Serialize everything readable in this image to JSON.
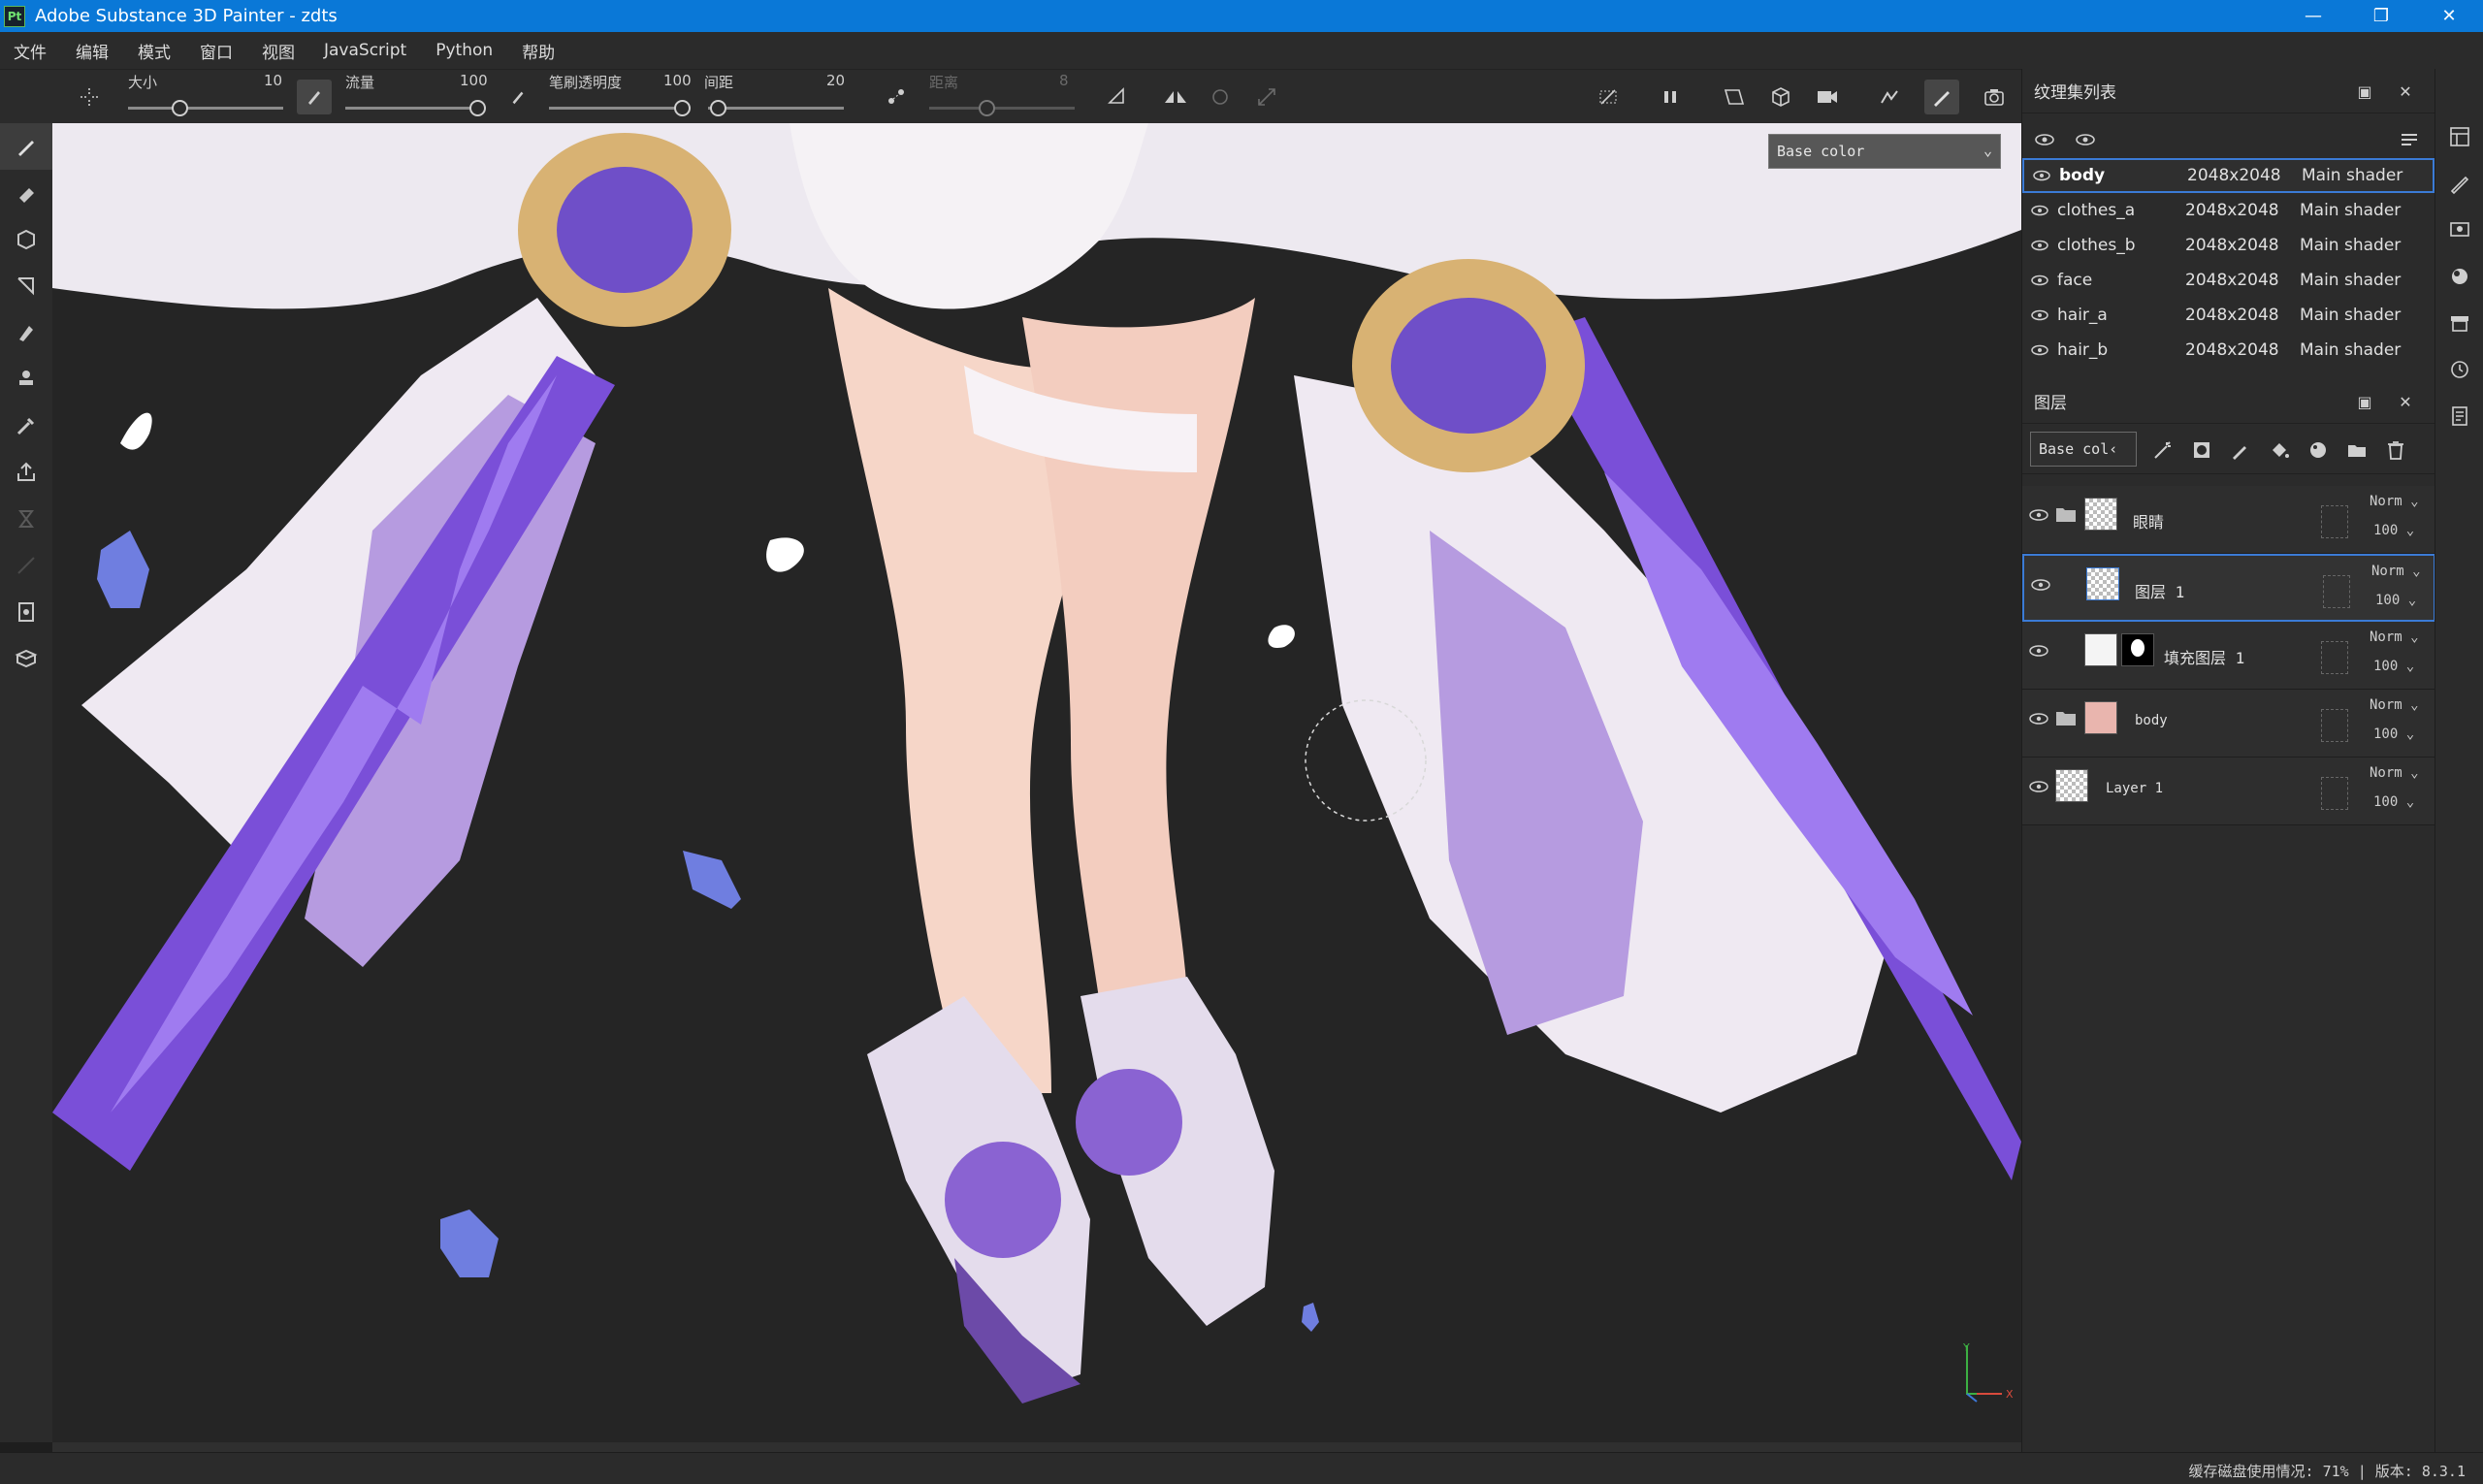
{
  "window": {
    "app_icon": "Pt",
    "title": "Adobe Substance 3D Painter - zdts",
    "buttons": [
      "minimize-icon",
      "restore-icon",
      "close-icon"
    ]
  },
  "menu": [
    "文件",
    "编辑",
    "模式",
    "窗口",
    "视图",
    "JavaScript",
    "Python",
    "帮助"
  ],
  "toolbar": {
    "size_label": "大小",
    "size_value": "10",
    "flow_label": "流量",
    "flow_value": "100",
    "opacity_label": "笔刷透明度",
    "opacity_value": "100",
    "spacing_label": "间距",
    "spacing_value": "20",
    "distance_label": "距离",
    "distance_value": "8"
  },
  "viewport": {
    "channel": "Base color",
    "axis_y": "Y",
    "axis_x": "X",
    "background": "#252525"
  },
  "texture_sets": {
    "title": "纹理集列表",
    "items": [
      {
        "name": "body",
        "resolution": "2048x2048",
        "shader": "Main shader",
        "selected": true
      },
      {
        "name": "clothes_a",
        "resolution": "2048x2048",
        "shader": "Main shader"
      },
      {
        "name": "clothes_b",
        "resolution": "2048x2048",
        "shader": "Main shader"
      },
      {
        "name": "face",
        "resolution": "2048x2048",
        "shader": "Main shader"
      },
      {
        "name": "hair_a",
        "resolution": "2048x2048",
        "shader": "Main shader"
      },
      {
        "name": "hair_b",
        "resolution": "2048x2048",
        "shader": "Main shader"
      }
    ]
  },
  "layers": {
    "title": "图层",
    "channel": "Base col‹",
    "items": [
      {
        "name": "眼睛",
        "blend": "Norm",
        "opacity": "100",
        "type": "folder"
      },
      {
        "name": "图层 1",
        "blend": "Norm",
        "opacity": "100",
        "type": "paint",
        "selected": true
      },
      {
        "name": "填充图层 1",
        "blend": "Norm",
        "opacity": "100",
        "type": "fill"
      },
      {
        "name": "body",
        "blend": "Norm",
        "opacity": "100",
        "type": "folder"
      },
      {
        "name": "Layer 1",
        "blend": "Norm",
        "opacity": "100",
        "type": "paint"
      }
    ]
  },
  "status": {
    "text": "缓存磁盘使用情况:  71% | 版本: 8.3.1"
  },
  "colors": {
    "accent": "#0a78d7",
    "selection": "#3b7bd6"
  }
}
